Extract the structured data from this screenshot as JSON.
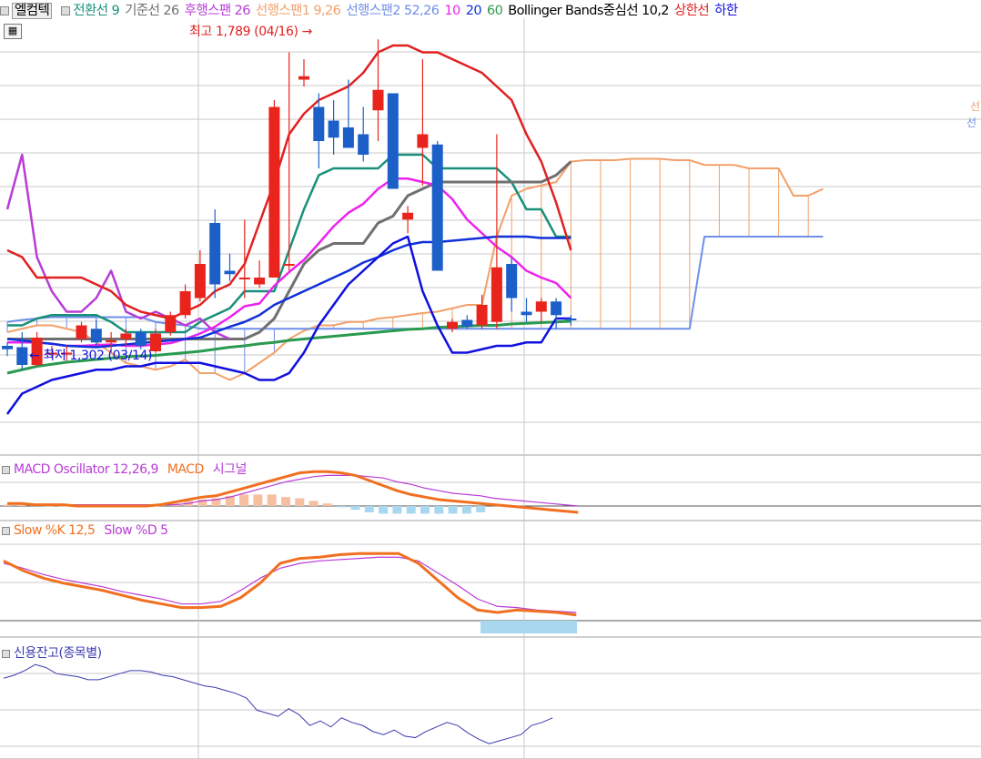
{
  "legend": {
    "stock_name": "엘컴텍",
    "items": [
      {
        "label": "전환선 9",
        "color": "#18907c"
      },
      {
        "label": "기준선 26",
        "color": "#707070"
      },
      {
        "label": "후행스팬 26",
        "color": "#b83cd6"
      },
      {
        "label": "선행스팬1 9,26",
        "color": "#f2a06a"
      },
      {
        "label": "선행스팬2 52,26",
        "color": "#6f8fe8"
      },
      {
        "label": "10",
        "color": "#ee22ee"
      },
      {
        "label": "20",
        "color": "#1030d8"
      },
      {
        "label": "60",
        "color": "#2a9a50"
      },
      {
        "label": "Bollinger Bands중심선 10,2",
        "color": "#000000"
      },
      {
        "label": "상한선",
        "color": "#e02020"
      },
      {
        "label": "하한",
        "color": "#1010e0"
      }
    ],
    "colors": {
      "up": "#e8241c",
      "down": "#1c5fc8"
    }
  },
  "annotations": {
    "high": "최고 1,789 (04/16)",
    "low": "최저 1,302 (03/14)",
    "arrow_right": "→",
    "arrow_left": "←"
  },
  "right_edge_labels": {
    "top": "선",
    "bottom": "선"
  },
  "chart_data": [
    {
      "type": "candlestick",
      "title": "엘컴텍",
      "ylim": [
        1180,
        1820
      ],
      "candles": [
        {
          "o": 1340,
          "h": 1345,
          "l": 1325,
          "c": 1335
        },
        {
          "o": 1338,
          "h": 1360,
          "l": 1305,
          "c": 1312
        },
        {
          "o": 1312,
          "h": 1360,
          "l": 1310,
          "c": 1352
        },
        {
          "o": 1330,
          "h": 1340,
          "l": 1322,
          "c": 1330
        },
        {
          "o": 1330,
          "h": 1340,
          "l": 1318,
          "c": 1330
        },
        {
          "o": 1350,
          "h": 1375,
          "l": 1345,
          "c": 1370
        },
        {
          "o": 1365,
          "h": 1378,
          "l": 1340,
          "c": 1345
        },
        {
          "o": 1345,
          "h": 1360,
          "l": 1330,
          "c": 1348
        },
        {
          "o": 1350,
          "h": 1365,
          "l": 1340,
          "c": 1358
        },
        {
          "o": 1360,
          "h": 1365,
          "l": 1335,
          "c": 1340
        },
        {
          "o": 1332,
          "h": 1365,
          "l": 1330,
          "c": 1358
        },
        {
          "o": 1360,
          "h": 1390,
          "l": 1355,
          "c": 1385
        },
        {
          "o": 1385,
          "h": 1430,
          "l": 1380,
          "c": 1420
        },
        {
          "o": 1410,
          "h": 1480,
          "l": 1405,
          "c": 1460
        },
        {
          "o": 1520,
          "h": 1540,
          "l": 1410,
          "c": 1430
        },
        {
          "o": 1450,
          "h": 1475,
          "l": 1435,
          "c": 1445
        },
        {
          "o": 1440,
          "h": 1525,
          "l": 1410,
          "c": 1440
        },
        {
          "o": 1430,
          "h": 1465,
          "l": 1425,
          "c": 1440
        },
        {
          "o": 1440,
          "h": 1700,
          "l": 1440,
          "c": 1690
        },
        {
          "o": 1460,
          "h": 1770,
          "l": 1450,
          "c": 1460
        },
        {
          "o": 1730,
          "h": 1760,
          "l": 1720,
          "c": 1735
        },
        {
          "o": 1690,
          "h": 1710,
          "l": 1600,
          "c": 1640
        },
        {
          "o": 1670,
          "h": 1700,
          "l": 1620,
          "c": 1645
        },
        {
          "o": 1660,
          "h": 1730,
          "l": 1630,
          "c": 1630
        },
        {
          "o": 1650,
          "h": 1690,
          "l": 1610,
          "c": 1620
        },
        {
          "o": 1685,
          "h": 1789,
          "l": 1640,
          "c": 1715
        },
        {
          "o": 1710,
          "h": 1710,
          "l": 1570,
          "c": 1570
        },
        {
          "o": 1525,
          "h": 1545,
          "l": 1505,
          "c": 1535
        },
        {
          "o": 1630,
          "h": 1760,
          "l": 1575,
          "c": 1650
        },
        {
          "o": 1635,
          "h": 1640,
          "l": 1450,
          "c": 1450
        },
        {
          "o": 1365,
          "h": 1380,
          "l": 1360,
          "c": 1375
        },
        {
          "o": 1378,
          "h": 1385,
          "l": 1365,
          "c": 1368
        },
        {
          "o": 1370,
          "h": 1415,
          "l": 1365,
          "c": 1400
        },
        {
          "o": 1375,
          "h": 1650,
          "l": 1365,
          "c": 1455
        },
        {
          "o": 1460,
          "h": 1470,
          "l": 1390,
          "c": 1410
        },
        {
          "o": 1390,
          "h": 1410,
          "l": 1375,
          "c": 1385
        },
        {
          "o": 1390,
          "h": 1410,
          "l": 1375,
          "c": 1405
        },
        {
          "o": 1405,
          "h": 1410,
          "l": 1365,
          "c": 1385
        },
        {
          "o": 1380,
          "h": 1385,
          "l": 1370,
          "c": 1378
        }
      ],
      "lines": [
        {
          "key": "conversion_9",
          "color": "#18907c",
          "values": [
            1370,
            1370,
            1380,
            1385,
            1385,
            1385,
            1385,
            1375,
            1360,
            1360,
            1360,
            1360,
            1360,
            1375,
            1385,
            1395,
            1420,
            1420,
            1420,
            1480,
            1540,
            1590,
            1600,
            1600,
            1600,
            1600,
            1620,
            1620,
            1620,
            1600,
            1600,
            1600,
            1600,
            1600,
            1580,
            1540,
            1540,
            1500,
            1500
          ]
        },
        {
          "key": "base_26",
          "color": "#707070",
          "values": [
            1350,
            1350,
            1350,
            1350,
            1350,
            1350,
            1350,
            1350,
            1350,
            1350,
            1350,
            1350,
            1350,
            1350,
            1350,
            1350,
            1350,
            1360,
            1380,
            1420,
            1460,
            1480,
            1490,
            1490,
            1490,
            1520,
            1530,
            1560,
            1570,
            1580,
            1580,
            1580,
            1580,
            1580,
            1580,
            1580,
            1580,
            1590,
            1610
          ]
        },
        {
          "key": "lagging_26",
          "color": "#b83cd6",
          "values": [
            1540,
            1620,
            1470,
            1420,
            1390,
            1390,
            1410,
            1450,
            1390,
            1380,
            1390,
            1380,
            1370,
            1380,
            1360,
            1350
          ]
        },
        {
          "key": "ma_10",
          "color": "#ee22ee",
          "values": [
            1345,
            1345,
            1345,
            1343,
            1340,
            1340,
            1341,
            1342,
            1340,
            1340,
            1342,
            1344,
            1350,
            1358,
            1368,
            1382,
            1398,
            1402,
            1428,
            1448,
            1466,
            1490,
            1515,
            1535,
            1548,
            1570,
            1585,
            1585,
            1580,
            1575,
            1555,
            1525,
            1505,
            1485,
            1470,
            1450,
            1440,
            1432,
            1410
          ]
        },
        {
          "key": "ma_20",
          "color": "#1030d8",
          "values": [
            1350,
            1348,
            1345,
            1343,
            1340,
            1339,
            1338,
            1340,
            1342,
            1344,
            1346,
            1348,
            1350,
            1352,
            1360,
            1368,
            1375,
            1385,
            1400,
            1410,
            1420,
            1430,
            1440,
            1450,
            1462,
            1470,
            1480,
            1488,
            1492,
            1492,
            1494,
            1496,
            1498,
            1500,
            1500,
            1500,
            1498,
            1498,
            1498
          ]
        },
        {
          "key": "ma_60",
          "color": "#2a9a50",
          "values": [
            1300,
            1305,
            1310,
            1313,
            1316,
            1318,
            1320,
            1322,
            1324,
            1325,
            1326,
            1328,
            1330,
            1332,
            1335,
            1338,
            1340,
            1343,
            1345,
            1348,
            1350,
            1352,
            1354,
            1356,
            1358,
            1360,
            1362,
            1364,
            1365,
            1367,
            1368,
            1369,
            1370,
            1370,
            1372,
            1373,
            1374,
            1375,
            1376
          ]
        },
        {
          "key": "boll_upper",
          "color": "#e02020",
          "values": [
            1480,
            1470,
            1440,
            1440,
            1440,
            1440,
            1430,
            1420,
            1400,
            1390,
            1385,
            1380,
            1390,
            1400,
            1420,
            1430,
            1460,
            1520,
            1580,
            1650,
            1680,
            1700,
            1710,
            1720,
            1740,
            1770,
            1780,
            1780,
            1770,
            1770,
            1760,
            1750,
            1740,
            1720,
            1700,
            1650,
            1610,
            1550,
            1480
          ]
        },
        {
          "key": "boll_lower",
          "color": "#1010e0",
          "values": [
            1240,
            1270,
            1280,
            1290,
            1295,
            1300,
            1305,
            1305,
            1310,
            1310,
            1315,
            1315,
            1315,
            1315,
            1310,
            1305,
            1300,
            1290,
            1290,
            1300,
            1330,
            1370,
            1400,
            1430,
            1450,
            1470,
            1490,
            1500,
            1420,
            1370,
            1330,
            1330,
            1335,
            1340,
            1340,
            1345,
            1345,
            1380,
            1380
          ]
        }
      ],
      "cloud": {
        "span1": {
          "color": "#f2a06a",
          "values": [
            1360,
            1365,
            1370,
            1370,
            1365,
            1360,
            1345,
            1330,
            1315,
            1310,
            1305,
            1310,
            1320,
            1300,
            1300,
            1290,
            1300,
            1315,
            1330,
            1350,
            1362,
            1370,
            1370,
            1375,
            1375,
            1380,
            1382,
            1385,
            1388,
            1390,
            1395,
            1400,
            1400,
            1500,
            1560,
            1570,
            1575,
            1580,
            1610,
            1612,
            1612,
            1612,
            1614,
            1614,
            1614,
            1612,
            1612,
            1605,
            1605,
            1605,
            1600,
            1600,
            1600,
            1560,
            1560,
            1570
          ]
        },
        "span2": {
          "color": "#6f8fe8",
          "values": [
            1375,
            1378,
            1380,
            1382,
            1382,
            1382,
            1382,
            1382,
            1382,
            1382,
            1375,
            1372,
            1370,
            1365,
            1365,
            1365,
            1365,
            1365,
            1365,
            1365,
            1365,
            1365,
            1365,
            1365,
            1365,
            1365,
            1365,
            1365,
            1365,
            1365,
            1365,
            1365,
            1365,
            1365,
            1365,
            1365,
            1365,
            1365,
            1365,
            1365,
            1365,
            1365,
            1365,
            1365,
            1365,
            1365,
            1365,
            1500,
            1500,
            1500,
            1500,
            1500,
            1500,
            1500,
            1500,
            1500
          ]
        }
      }
    },
    {
      "type": "bar-line",
      "title": "MACD Oscillator 12,26,9",
      "oscillator": [
        1,
        1,
        1,
        0.5,
        0.5,
        0.5,
        0.5,
        0.5,
        0.5,
        0.5,
        1,
        1,
        2,
        4,
        5,
        6,
        8,
        9,
        9,
        9,
        7,
        6,
        4,
        2,
        -1,
        -3,
        -5,
        -6,
        -6,
        -6,
        -6,
        -6,
        -6,
        -6,
        -5
      ],
      "macd": [
        2,
        2,
        1,
        1,
        1,
        0,
        0,
        0,
        0,
        0,
        0,
        1,
        3,
        5,
        7,
        8,
        11,
        14,
        17,
        20,
        23,
        26,
        27,
        27,
        26,
        24,
        20,
        16,
        12,
        9,
        7,
        5,
        4,
        3,
        2,
        1,
        0,
        -1,
        -2,
        -3,
        -4,
        -5
      ],
      "signal": [
        2,
        2,
        1,
        1,
        1,
        1,
        1,
        1,
        1,
        1,
        1,
        1,
        1,
        2,
        4,
        5,
        7,
        10,
        13,
        16,
        19,
        21,
        23,
        24,
        24,
        24,
        23,
        22,
        19,
        17,
        14,
        12,
        10,
        9,
        8,
        6,
        5,
        4,
        3,
        2,
        1,
        0
      ],
      "legend": [
        {
          "label": "MACD Oscillator 12,26,9",
          "color": "#b83cd6"
        },
        {
          "label": "MACD",
          "color": "#f07020"
        },
        {
          "label": "시그널",
          "color": "#b83cd6"
        }
      ]
    },
    {
      "type": "line",
      "title": "Slow %K 12,5",
      "k": [
        62,
        54,
        48,
        44,
        41,
        38,
        34,
        30,
        27,
        24,
        24,
        25,
        32,
        44,
        60,
        64,
        65,
        67,
        68,
        68,
        68,
        60,
        46,
        32,
        22,
        20,
        22,
        21,
        20,
        18
      ],
      "d": [
        60,
        56,
        51,
        47,
        44,
        41,
        37,
        34,
        31,
        27,
        27,
        29,
        38,
        48,
        56,
        60,
        62,
        63,
        64,
        65,
        65,
        62,
        52,
        42,
        31,
        25,
        24,
        22,
        21,
        20
      ],
      "legend": [
        {
          "label": "Slow %K 12,5",
          "color": "#f07020"
        },
        {
          "label": "Slow %D 5",
          "color": "#b83cd6"
        }
      ]
    },
    {
      "type": "line",
      "title": "신용잔고(종목별)",
      "values": [
        53,
        55,
        58,
        62,
        60,
        56,
        55,
        54,
        52,
        52,
        54,
        56,
        58,
        58,
        57,
        55,
        54,
        52,
        50,
        48,
        47,
        45,
        43,
        40,
        32,
        30,
        28,
        33,
        29,
        22,
        25,
        21,
        27,
        24,
        22,
        18,
        16,
        19,
        15,
        14,
        18,
        21,
        24,
        22,
        17,
        13,
        10,
        12,
        14,
        16,
        22,
        24,
        27
      ]
    }
  ]
}
